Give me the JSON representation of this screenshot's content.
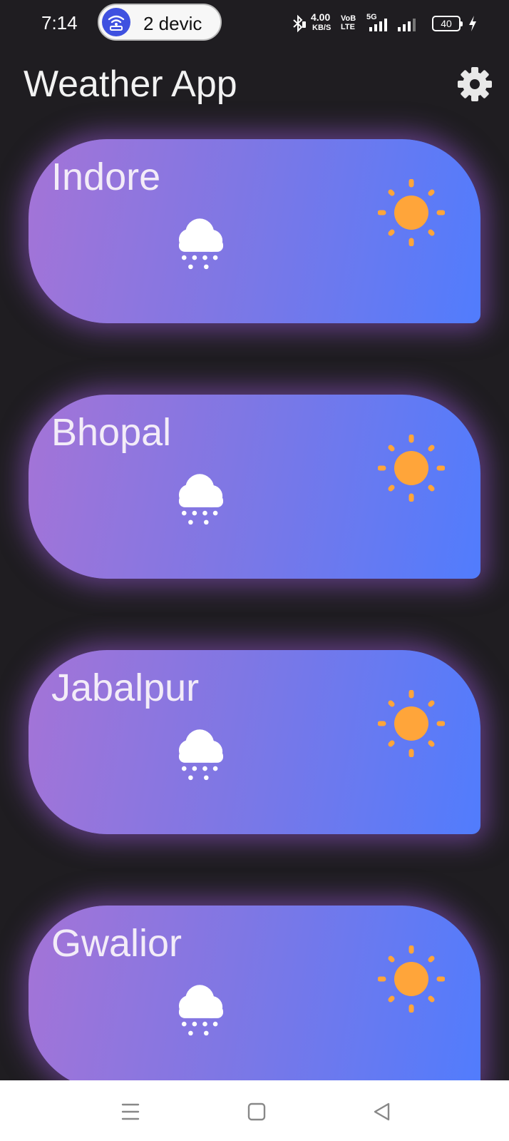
{
  "status_bar": {
    "time": "7:14",
    "hotspot_label": "2 devic",
    "speed_value": "4.00",
    "speed_unit": "KB/S",
    "volte_top": "VoB",
    "volte_bottom": "LTE",
    "network": "5G",
    "battery": "40",
    "icons": [
      "hotspot-icon",
      "bluetooth-icon",
      "signal-icon",
      "signal-icon",
      "battery-icon",
      "charging-icon"
    ]
  },
  "app_bar": {
    "title": "Weather App",
    "settings_icon": "gear-icon"
  },
  "cities": [
    {
      "name": "Indore",
      "icons": [
        "snow-cloud-icon",
        "sun-icon"
      ]
    },
    {
      "name": "Bhopal",
      "icons": [
        "snow-cloud-icon",
        "sun-icon"
      ]
    },
    {
      "name": "Jabalpur",
      "icons": [
        "snow-cloud-icon",
        "sun-icon"
      ]
    },
    {
      "name": "Gwalior",
      "icons": [
        "snow-cloud-icon",
        "sun-icon"
      ]
    }
  ],
  "nav_bar": {
    "icons": [
      "menu-icon",
      "home-icon",
      "back-icon"
    ]
  },
  "colors": {
    "background": "#1f1d21",
    "card_gradient_start": "#a474d7",
    "card_gradient_end": "#517cfd",
    "sun": "#ffa53a",
    "hotspot_accent": "#3f51e0"
  }
}
